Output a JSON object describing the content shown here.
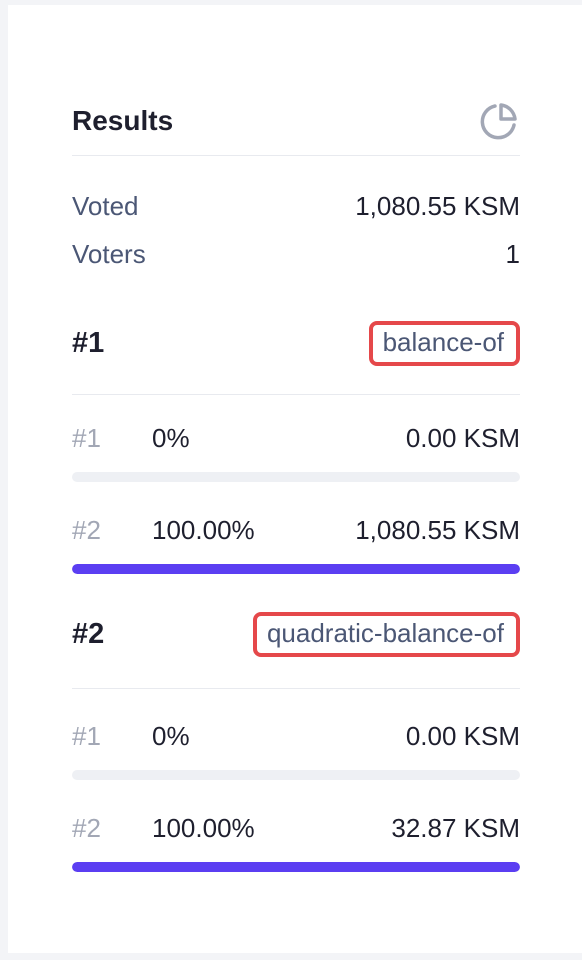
{
  "results": {
    "title": "Results",
    "icon": "pie-chart-icon",
    "voted_label": "Voted",
    "voted_value": "1,080.55 KSM",
    "voters_label": "Voters",
    "voters_value": "1"
  },
  "strategies": [
    {
      "index": "#1",
      "name": "balance-of",
      "choices": [
        {
          "index": "#1",
          "percent": "0%",
          "amount": "0.00 KSM",
          "progress": 0
        },
        {
          "index": "#2",
          "percent": "100.00%",
          "amount": "1,080.55 KSM",
          "progress": 1
        }
      ]
    },
    {
      "index": "#2",
      "name": "quadratic-balance-of",
      "choices": [
        {
          "index": "#1",
          "percent": "0%",
          "amount": "0.00 KSM",
          "progress": 0
        },
        {
          "index": "#2",
          "percent": "100.00%",
          "amount": "32.87 KSM",
          "progress": 1
        }
      ]
    }
  ],
  "colors": {
    "accent": "#5b3ef2",
    "highlight_border": "#e5484a",
    "track": "#eef0f4"
  }
}
